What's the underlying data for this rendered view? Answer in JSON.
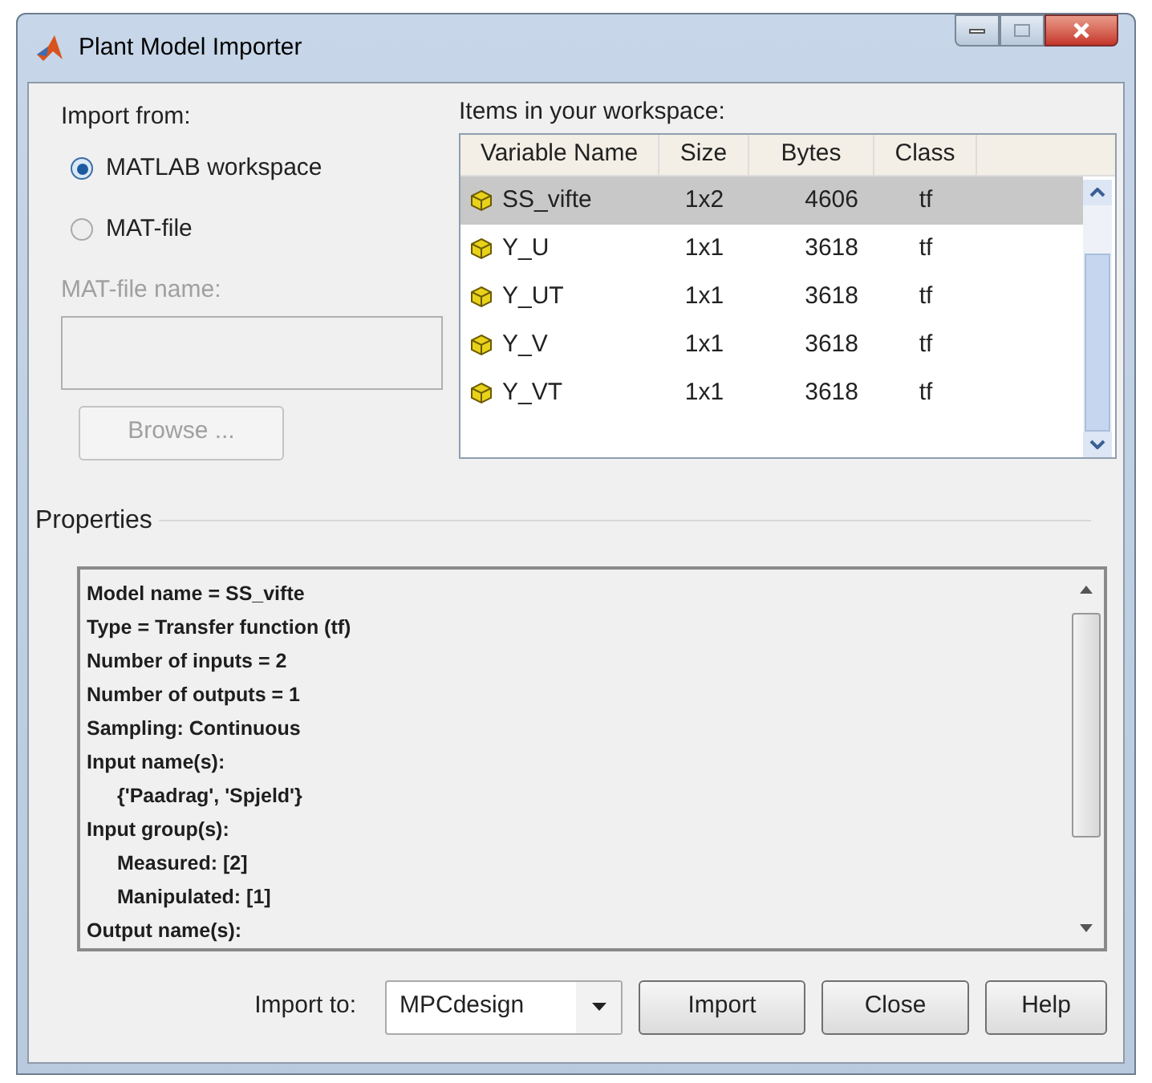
{
  "window": {
    "title": "Plant Model Importer"
  },
  "import_from": {
    "label": "Import from:",
    "options": [
      {
        "label": "MATLAB workspace",
        "selected": true
      },
      {
        "label": "MAT-file",
        "selected": false
      }
    ],
    "file_name": {
      "label": "MAT-file name:",
      "disabled": true
    },
    "browse_button": {
      "label": "Browse ...",
      "disabled": true
    }
  },
  "workspace": {
    "label": "Items in your workspace:",
    "columns": [
      "Variable Name",
      "Size",
      "Bytes",
      "Class"
    ],
    "rows": [
      {
        "name": "SS_vifte",
        "size": "1x2",
        "bytes": "4606",
        "class": "tf",
        "selected": true
      },
      {
        "name": "Y_U",
        "size": "1x1",
        "bytes": "3618",
        "class": "tf",
        "selected": false
      },
      {
        "name": "Y_UT",
        "size": "1x1",
        "bytes": "3618",
        "class": "tf",
        "selected": false
      },
      {
        "name": "Y_V",
        "size": "1x1",
        "bytes": "3618",
        "class": "tf",
        "selected": false
      },
      {
        "name": "Y_VT",
        "size": "1x1",
        "bytes": "3618",
        "class": "tf",
        "selected": false
      }
    ]
  },
  "properties": {
    "title": "Properties",
    "lines": [
      {
        "text": "Model name = SS_vifte",
        "indent": false
      },
      {
        "text": "Type = Transfer function (tf)",
        "indent": false
      },
      {
        "text": "Number of inputs = 2",
        "indent": false
      },
      {
        "text": "Number of outputs = 1",
        "indent": false
      },
      {
        "text": "Sampling: Continuous",
        "indent": false
      },
      {
        "text": "Input name(s):",
        "indent": false
      },
      {
        "text": "{'Paadrag', 'Spjeld'}",
        "indent": true
      },
      {
        "text": "Input group(s):",
        "indent": false
      },
      {
        "text": "Measured: [2]",
        "indent": true
      },
      {
        "text": "Manipulated: [1]",
        "indent": true
      },
      {
        "text": "Output name(s):",
        "indent": false
      }
    ]
  },
  "footer": {
    "import_to_label": "Import to:",
    "target": "MPCdesign",
    "buttons": [
      "Import",
      "Close",
      "Help"
    ]
  }
}
